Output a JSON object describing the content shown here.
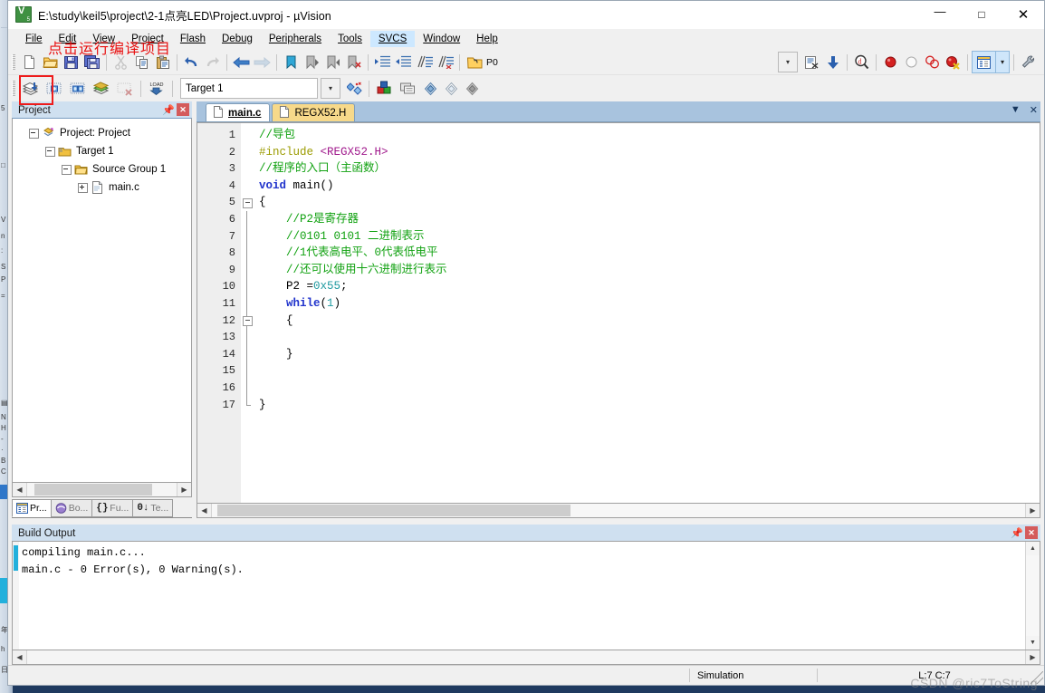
{
  "window": {
    "title": "E:\\study\\keil5\\project\\2-1点亮LED\\Project.uvproj - µVision",
    "app_icon": "uvision-icon",
    "minimize": "—",
    "maximize": "□",
    "close": "✕"
  },
  "menubar": {
    "items": [
      {
        "label": "File",
        "active": false
      },
      {
        "label": "Edit",
        "active": false
      },
      {
        "label": "View",
        "active": false
      },
      {
        "label": "Project",
        "active": false
      },
      {
        "label": "Flash",
        "active": false
      },
      {
        "label": "Debug",
        "active": false
      },
      {
        "label": "Peripherals",
        "active": false
      },
      {
        "label": "Tools",
        "active": false
      },
      {
        "label": "SVCS",
        "active": true
      },
      {
        "label": "Window",
        "active": false
      },
      {
        "label": "Help",
        "active": false
      }
    ]
  },
  "annotation": {
    "text": "点击运行编译项目",
    "color": "#ee1b1b",
    "highlight_target": "build-button"
  },
  "toolbar_main": {
    "buttons": [
      {
        "name": "new-file-icon",
        "title": "New"
      },
      {
        "name": "open-file-icon",
        "title": "Open"
      },
      {
        "name": "save-icon",
        "title": "Save"
      },
      {
        "name": "save-all-icon",
        "title": "Save All"
      },
      {
        "name": "cut-icon",
        "title": "Cut"
      },
      {
        "name": "copy-icon",
        "title": "Copy"
      },
      {
        "name": "paste-icon",
        "title": "Paste"
      },
      {
        "name": "undo-icon",
        "title": "Undo"
      },
      {
        "name": "redo-icon",
        "title": "Redo"
      },
      {
        "name": "navigate-back-icon",
        "title": "Back"
      },
      {
        "name": "navigate-forward-icon",
        "title": "Forward"
      },
      {
        "name": "bookmark-toggle-icon",
        "title": "Toggle Bookmark"
      },
      {
        "name": "bookmark-prev-icon",
        "title": "Previous Bookmark"
      },
      {
        "name": "bookmark-next-icon",
        "title": "Next Bookmark"
      },
      {
        "name": "bookmark-clear-icon",
        "title": "Clear Bookmarks"
      },
      {
        "name": "indent-icon",
        "title": "Indent"
      },
      {
        "name": "outdent-icon",
        "title": "Outdent"
      },
      {
        "name": "comment-icon",
        "title": "Comment"
      },
      {
        "name": "uncomment-icon",
        "title": "Uncomment"
      },
      {
        "name": "open-config-icon",
        "title": "Configuration"
      }
    ],
    "port_label": "P0",
    "right_buttons": [
      {
        "name": "dropdown-arrow-icon",
        "title": "More"
      },
      {
        "name": "disassembly-icon",
        "title": "Disassembly Window"
      },
      {
        "name": "download-icon",
        "title": "Download"
      },
      {
        "name": "find-in-files-icon",
        "title": "Find in Files"
      },
      {
        "name": "breakpoint-icon",
        "title": "Insert/Remove Breakpoint"
      },
      {
        "name": "breakpoint-disable-icon",
        "title": "Enable/Disable Breakpoint"
      },
      {
        "name": "breakpoint-disable-all-icon",
        "title": "Disable All Breakpoints"
      },
      {
        "name": "breakpoint-kill-all-icon",
        "title": "Kill All Breakpoints"
      },
      {
        "name": "project-window-icon",
        "title": "Project Window"
      },
      {
        "name": "project-window-dropdown-icon",
        "title": "Windows"
      },
      {
        "name": "configure-icon",
        "title": "Configure"
      }
    ]
  },
  "toolbar_build": {
    "buttons": [
      {
        "name": "build-button",
        "title": "Build"
      },
      {
        "name": "rebuild-button",
        "title": "Rebuild"
      },
      {
        "name": "batch-build-button",
        "title": "Batch Build"
      },
      {
        "name": "translate-button",
        "title": "Translate"
      },
      {
        "name": "stop-build-button",
        "title": "Stop Build"
      },
      {
        "name": "download-load-button",
        "title": "Download (LOAD)"
      }
    ],
    "target_value": "Target 1",
    "right_buttons": [
      {
        "name": "target-options-icon",
        "title": "Options for Target"
      },
      {
        "name": "manage-components-icon",
        "title": "Manage Project Items"
      },
      {
        "name": "manage-run-env-icon",
        "title": "Manage Run-Time Environment"
      },
      {
        "name": "pack-installer-icon",
        "title": "Pack Installer"
      },
      {
        "name": "multi-project-icon",
        "title": "Multi-Project"
      },
      {
        "name": "select-target-icon",
        "title": "Select Target"
      }
    ]
  },
  "project_pane": {
    "caption": "Project",
    "pin_icon": "pin-icon",
    "close_icon": "close-icon",
    "tree": [
      {
        "label": "Project: Project",
        "icon": "project-icon",
        "expander": "minus",
        "depth": 0
      },
      {
        "label": "Target 1",
        "icon": "target-folder-icon",
        "expander": "minus",
        "depth": 1
      },
      {
        "label": "Source Group 1",
        "icon": "folder-icon",
        "expander": "minus",
        "depth": 2
      },
      {
        "label": "main.c",
        "icon": "c-file-icon",
        "expander": "plus",
        "depth": 3
      }
    ],
    "tabs": [
      {
        "label": "Pr...",
        "icon": "project-icon",
        "selected": true
      },
      {
        "label": "Bo...",
        "icon": "books-icon",
        "selected": false
      },
      {
        "label": "Fu...",
        "icon": "functions-icon",
        "selected": false
      },
      {
        "label": "Te...",
        "icon": "templates-icon",
        "selected": false
      }
    ]
  },
  "editor": {
    "tabs": [
      {
        "label": "main.c",
        "icon": "c-file-icon",
        "selected": true
      },
      {
        "label": "REGX52.H",
        "icon": "h-file-icon",
        "selected": false
      }
    ],
    "tab_dropdown_icon": "chevron-down-icon",
    "tab_close_icon": "close-icon",
    "lines": [
      {
        "n": "1",
        "fold": "",
        "tokens": [
          {
            "t": "//导包",
            "c": "cm"
          }
        ]
      },
      {
        "n": "2",
        "fold": "",
        "tokens": [
          {
            "t": "#include ",
            "c": "pp"
          },
          {
            "t": "<REGX52.H>",
            "c": "ppa"
          }
        ]
      },
      {
        "n": "3",
        "fold": "",
        "tokens": [
          {
            "t": "//程序的入口（主函数）",
            "c": "cm"
          }
        ]
      },
      {
        "n": "4",
        "fold": "",
        "tokens": [
          {
            "t": "void",
            "c": "kw"
          },
          {
            "t": " main()",
            "c": "pl"
          }
        ]
      },
      {
        "n": "5",
        "fold": "box",
        "tokens": [
          {
            "t": "{",
            "c": "pl"
          }
        ]
      },
      {
        "n": "6",
        "fold": "line",
        "tokens": [
          {
            "t": "    //P2是寄存器",
            "c": "cm"
          }
        ]
      },
      {
        "n": "7",
        "fold": "line",
        "tokens": [
          {
            "t": "    //0101 0101 二进制表示",
            "c": "cm"
          }
        ]
      },
      {
        "n": "8",
        "fold": "line",
        "tokens": [
          {
            "t": "    //1代表高电平、0代表低电平",
            "c": "cm"
          }
        ]
      },
      {
        "n": "9",
        "fold": "line",
        "tokens": [
          {
            "t": "    //还可以使用十六进制进行表示",
            "c": "cm"
          }
        ]
      },
      {
        "n": "10",
        "fold": "line",
        "tokens": [
          {
            "t": "    P2 =",
            "c": "pl"
          },
          {
            "t": "0x55",
            "c": "num"
          },
          {
            "t": ";",
            "c": "pl"
          }
        ]
      },
      {
        "n": "11",
        "fold": "line",
        "tokens": [
          {
            "t": "    ",
            "c": "pl"
          },
          {
            "t": "while",
            "c": "kw"
          },
          {
            "t": "(",
            "c": "pl"
          },
          {
            "t": "1",
            "c": "num"
          },
          {
            "t": ")",
            "c": "pl"
          }
        ]
      },
      {
        "n": "12",
        "fold": "box",
        "tokens": [
          {
            "t": "    {",
            "c": "pl"
          }
        ]
      },
      {
        "n": "13",
        "fold": "line",
        "tokens": [
          {
            "t": "",
            "c": "pl"
          }
        ]
      },
      {
        "n": "14",
        "fold": "line",
        "tokens": [
          {
            "t": "    }",
            "c": "pl"
          }
        ]
      },
      {
        "n": "15",
        "fold": "line",
        "tokens": [
          {
            "t": "",
            "c": "pl"
          }
        ]
      },
      {
        "n": "16",
        "fold": "line",
        "tokens": [
          {
            "t": "",
            "c": "pl"
          }
        ]
      },
      {
        "n": "17",
        "fold": "end",
        "tokens": [
          {
            "t": "}",
            "c": "pl"
          }
        ]
      }
    ]
  },
  "build_output": {
    "caption": "Build Output",
    "pin_icon": "pin-icon",
    "close_icon": "close-icon",
    "lines": [
      "compiling main.c...",
      "main.c - 0 Error(s), 0 Warning(s)."
    ]
  },
  "statusbar": {
    "left": "",
    "simulation": "Simulation",
    "cursor": "L:7 C:7"
  },
  "watermark": {
    "text": "CSDN @ric7ToString"
  }
}
